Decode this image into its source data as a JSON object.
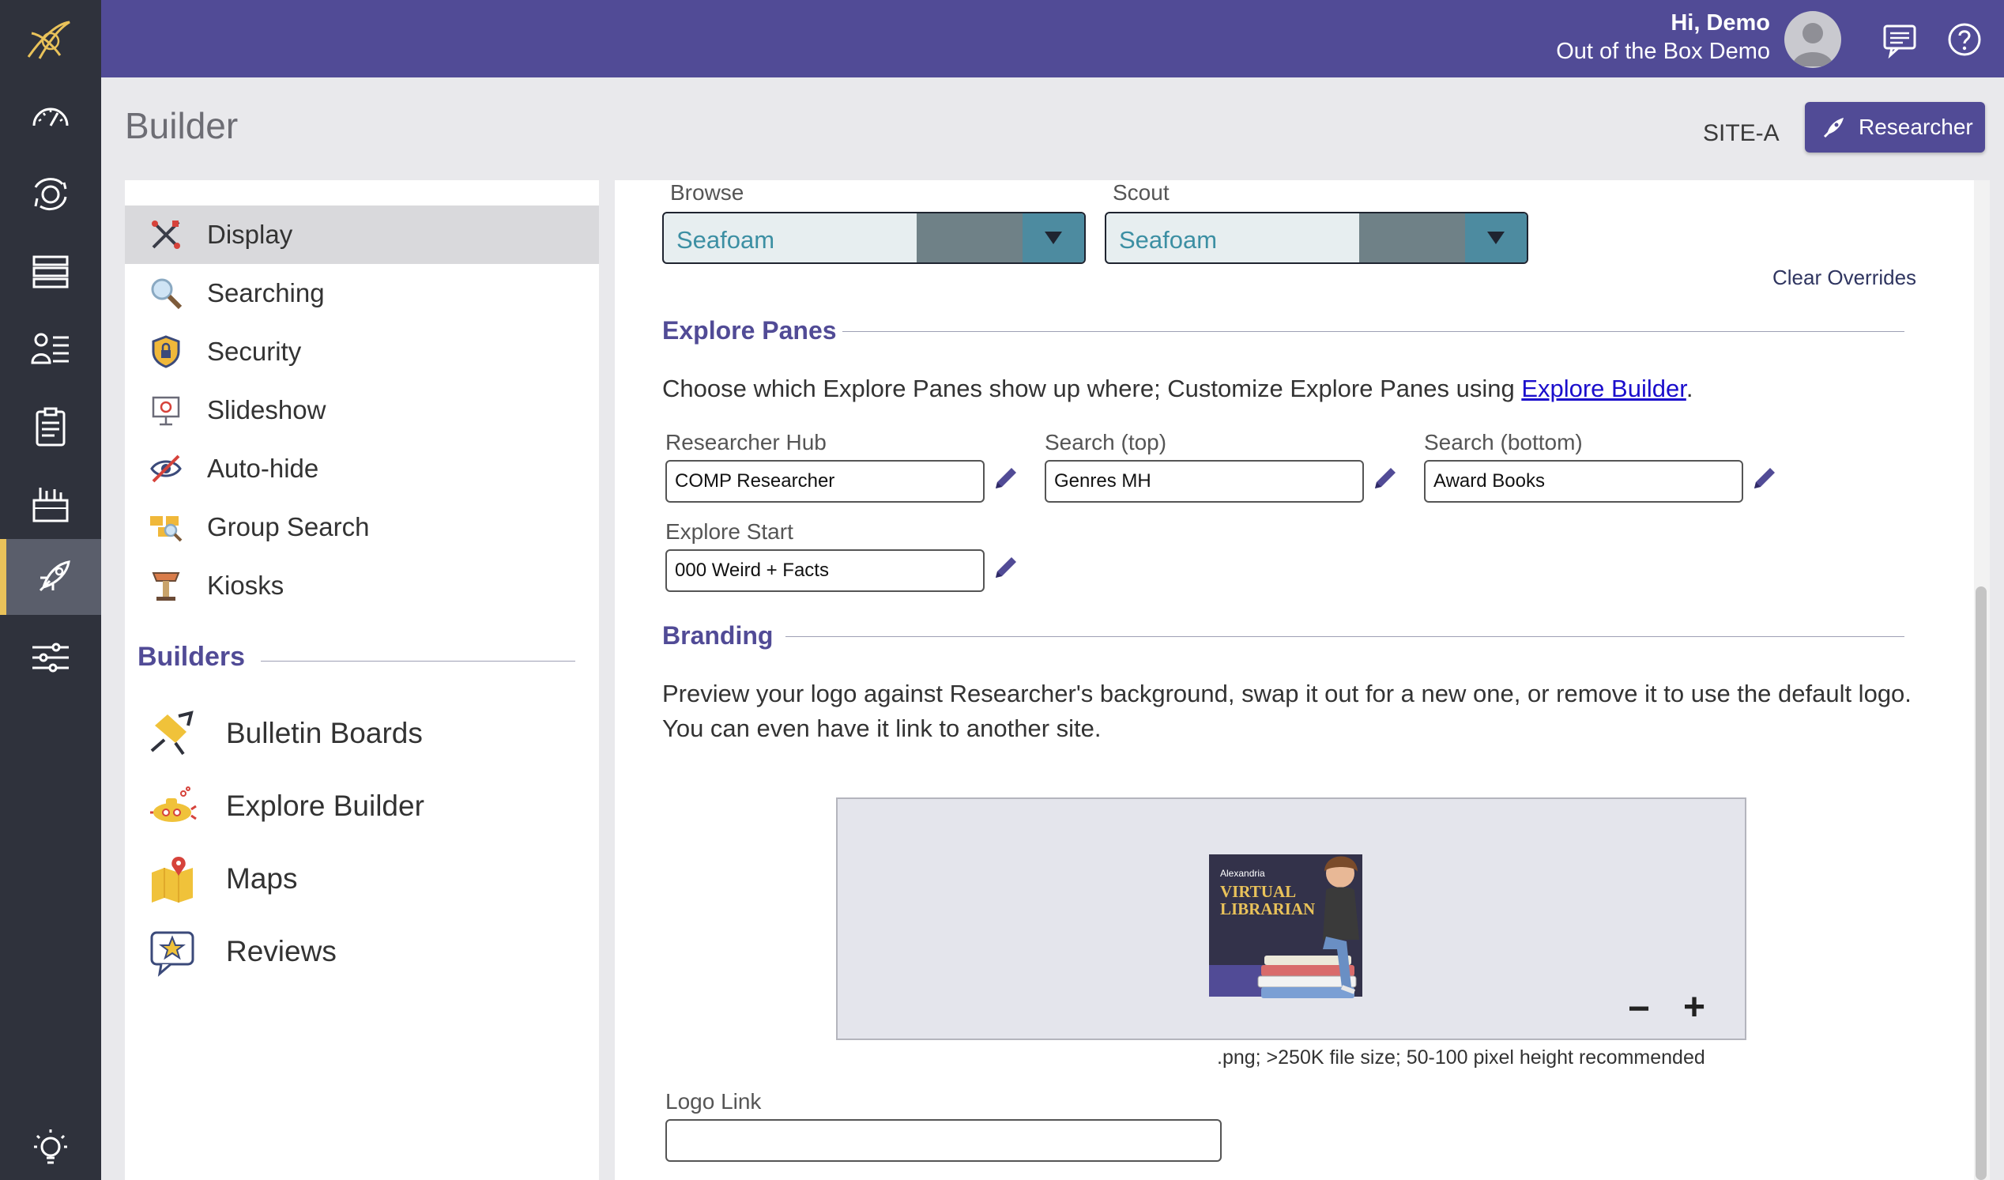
{
  "user": {
    "greeting": "Hi, Demo",
    "organization": "Out of the Box Demo"
  },
  "header": {
    "title": "Builder",
    "site": "SITE-A",
    "researcher_button": "Researcher"
  },
  "rail": {
    "items": [
      "dashboard-icon",
      "circulation-icon",
      "catalog-icon",
      "patrons-icon",
      "reports-icon",
      "tools-icon",
      "builder-icon",
      "settings-icon",
      "tips-icon"
    ],
    "active": "builder-icon"
  },
  "sidebar": {
    "items": [
      {
        "label": "Display",
        "icon": "display-tools-icon"
      },
      {
        "label": "Searching",
        "icon": "magnifier-icon"
      },
      {
        "label": "Security",
        "icon": "shield-lock-icon"
      },
      {
        "label": "Slideshow",
        "icon": "presentation-icon"
      },
      {
        "label": "Auto-hide",
        "icon": "eye-slash-icon"
      },
      {
        "label": "Group Search",
        "icon": "group-search-icon"
      },
      {
        "label": "Kiosks",
        "icon": "kiosk-icon"
      }
    ],
    "active_index": 0,
    "builders_heading": "Builders",
    "builders": [
      {
        "label": "Bulletin Boards",
        "icon": "pushpin-icon"
      },
      {
        "label": "Explore Builder",
        "icon": "submarine-icon"
      },
      {
        "label": "Maps",
        "icon": "map-pin-icon"
      },
      {
        "label": "Reviews",
        "icon": "star-bubble-icon"
      }
    ]
  },
  "themes": {
    "browse_label": "Browse",
    "browse_value": "Seafoam",
    "scout_label": "Scout",
    "scout_value": "Seafoam",
    "clear_overrides": "Clear Overrides"
  },
  "explore_panes": {
    "heading": "Explore Panes",
    "description": "Choose which Explore Panes show up where; Customize Explore Panes using ",
    "link": "Explore Builder",
    "period": ".",
    "fields": [
      {
        "label": "Researcher Hub",
        "value": "COMP Researcher"
      },
      {
        "label": "Search (top)",
        "value": "Genres MH"
      },
      {
        "label": "Search (bottom)",
        "value": "Award Books"
      },
      {
        "label": "Explore Start",
        "value": "000 Weird + Facts"
      }
    ]
  },
  "branding": {
    "heading": "Branding",
    "description": "Preview your logo against Researcher's background, swap it out for a new one, or remove it to use the default logo. You can even have it link to another site.",
    "logo_small": "Alexandria",
    "logo_line1": "VIRTUAL",
    "logo_line2": "LIBRARIAN",
    "zoom_out": "−",
    "zoom_in": "+",
    "hint": ".png; >250K file size; 50-100 pixel height recommended",
    "logo_link_label": "Logo Link",
    "logo_link_value": ""
  },
  "colors": {
    "brand": "#514b96",
    "rail": "#2f323c",
    "accent": "#e9c25a",
    "select_text": "#3c8fa3"
  }
}
